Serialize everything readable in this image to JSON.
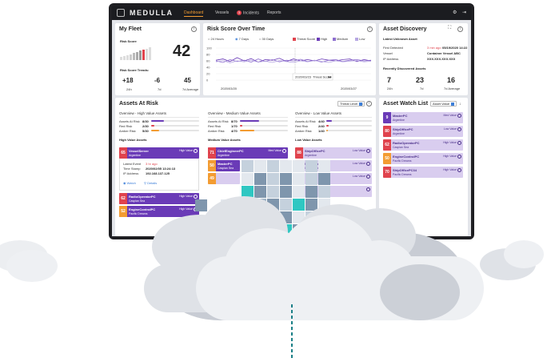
{
  "brand": {
    "name": "MEDULLA"
  },
  "nav": {
    "items": [
      {
        "label": "Dashboard"
      },
      {
        "label": "Vessels"
      },
      {
        "label": "Incidents",
        "badge": "3"
      },
      {
        "label": "Reports"
      }
    ],
    "active_color": "#f39c32"
  },
  "fleet": {
    "title": "My Fleet",
    "risk_score_label": "Risk Score",
    "risk_score": "42",
    "trends_label": "Risk Score Trends:",
    "trends": [
      {
        "value": "+18",
        "caption": "24h"
      },
      {
        "value": "-6",
        "caption": "7d"
      },
      {
        "value": "45",
        "caption": "7d Average"
      }
    ]
  },
  "risk_chart": {
    "title": "Risk Score Over Time",
    "ranges": [
      "24 Hours",
      "7 Days",
      "30 Days"
    ],
    "selected_range": "7 Days",
    "legend": [
      "Threat Score",
      "High",
      "Medium",
      "Low"
    ],
    "y_ticks": [
      "100",
      "80",
      "60",
      "40",
      "20",
      "0"
    ],
    "x_ticks": [
      "2020/03/20",
      "2020/03/27"
    ],
    "tooltip": {
      "date": "2020/03/23",
      "label": "Threat Score",
      "value": "64"
    }
  },
  "chart_data": {
    "type": "line",
    "title": "Risk Score Over Time",
    "ylim": [
      0,
      100
    ],
    "series": [
      {
        "name": "High",
        "values": [
          62,
          66,
          58,
          70,
          60,
          67,
          56,
          64,
          62,
          68,
          58,
          66,
          60,
          64,
          60,
          66,
          62,
          60,
          64,
          66,
          58,
          64,
          60
        ]
      },
      {
        "name": "Medium",
        "values": [
          60,
          55,
          64,
          58,
          62,
          56,
          66,
          58,
          64,
          57,
          62,
          60,
          65,
          58,
          62,
          56,
          62,
          64,
          58,
          62,
          64,
          60,
          62
        ]
      },
      {
        "name": "Low",
        "values": [
          57,
          61,
          54,
          60,
          57,
          62,
          56,
          59,
          55,
          61,
          58,
          55,
          60,
          57,
          61,
          58,
          55,
          60,
          57,
          59,
          61,
          57,
          59
        ]
      }
    ]
  },
  "asset_discovery": {
    "title": "Asset Discovery",
    "latest_unknown_label": "Latest Unknown Asset",
    "fields": [
      {
        "key": "First Detected",
        "ago": "3 min ago",
        "value": "05/19/2020 14:22"
      },
      {
        "key": "Vessel",
        "value": "Container Vessel ABC"
      },
      {
        "key": "IP Address",
        "value": "XXX.XXX.XXX.XXX"
      }
    ],
    "recent_label": "Recently Discovered Assets",
    "stats": [
      {
        "value": "7",
        "caption": "24h"
      },
      {
        "value": "23",
        "caption": "7d"
      },
      {
        "value": "16",
        "caption": "7d Average"
      }
    ]
  },
  "assets_at_risk": {
    "title": "Assets At Risk",
    "threat_select": "Threat Level",
    "columns": [
      {
        "overview": "Overview - High Value Assets",
        "rows": [
          {
            "label": "Assets At Risk",
            "value": "8/30",
            "color": "#6a3bb7",
            "pct": 0.27
          },
          {
            "label": "Red Risk",
            "value": "2/30",
            "color": "#e0434d",
            "pct": 0.07
          },
          {
            "label": "Amber Risk",
            "value": "5/30",
            "color": "#f39c32",
            "pct": 0.17
          }
        ],
        "section": "High Value Assets"
      },
      {
        "overview": "Overview - Medium Value Assets",
        "rows": [
          {
            "label": "Assets At Risk",
            "value": "8/70",
            "color": "#6a3bb7",
            "pct": 0.4
          },
          {
            "label": "Red Risk",
            "value": "1/70",
            "color": "#e0434d",
            "pct": 0.05
          },
          {
            "label": "Amber Risk",
            "value": "4/70",
            "color": "#f39c32",
            "pct": 0.3
          }
        ],
        "section": "Medium Value Assets"
      },
      {
        "overview": "Overview - Low Value Assets",
        "rows": [
          {
            "label": "Assets At Risk",
            "value": "4/40",
            "color": "#6a3bb7",
            "pct": 0.12
          },
          {
            "label": "Red Risk",
            "value": "2/40",
            "color": "#e0434d",
            "pct": 0.06
          },
          {
            "label": "Amber Risk",
            "value": "1/40",
            "color": "#f39c32",
            "pct": 0.04
          }
        ],
        "section": "Low Value Assets"
      }
    ],
    "high_assets": [
      {
        "score": "65",
        "name": "VesselServer",
        "sub": "Argentine",
        "tag": "High Value"
      },
      {
        "score": "62",
        "name": "RadioOperatorPC",
        "sub": "Caspian Sea",
        "tag": "High Value"
      },
      {
        "score": "52",
        "name": "EngineControlPC",
        "sub": "Pacific Dreams",
        "tag": "High Value"
      }
    ],
    "expanded": {
      "fields": [
        {
          "key": "Latest Event",
          "value": "3 hr ago"
        },
        {
          "key": "Time Stamp",
          "value": "2020/02/05 13:24:13"
        },
        {
          "key": "IP Address",
          "value": "192.168.137.125"
        }
      ],
      "actions": [
        "Watch",
        "Details"
      ]
    },
    "medium_assets": [
      {
        "score": "71",
        "name": "ChiefEngineerPC",
        "sub": "Argentine",
        "tag": "Med Value"
      },
      {
        "score": "50",
        "name": "MasterPC",
        "sub": "Caspian Sea",
        "tag": "Med Value"
      },
      {
        "score": "49",
        "name": "",
        "sub": "",
        "tag": ""
      }
    ],
    "low_assets": [
      {
        "score": "88",
        "name": "ShipOfficePC",
        "sub": "Argentine",
        "tag": "Low Value"
      },
      {
        "score": "60",
        "name": "ShipOfficePC2",
        "sub": "Caspian Sea",
        "tag": "Low Value"
      },
      {
        "score": "",
        "name": "",
        "sub": "",
        "tag": "Low Value"
      },
      {
        "score": "",
        "name": "",
        "sub": "",
        "tag": ""
      }
    ]
  },
  "watch_list": {
    "title": "Asset Watch List",
    "select": "Asset Value",
    "items": [
      {
        "score": "9",
        "name": "MasterPC",
        "sub": "Argentine",
        "tag": "Med Value",
        "color": "#6a3bb7"
      },
      {
        "score": "80",
        "name": "ShipOfficePC",
        "sub": "Argentine",
        "tag": "Low Value",
        "color": "#e0434d"
      },
      {
        "score": "62",
        "name": "RadioOperatorPC",
        "sub": "Caspian Sea",
        "tag": "High Value",
        "color": "#e0434d"
      },
      {
        "score": "50",
        "name": "EngineControlPC",
        "sub": "Pacific Dreams",
        "tag": "High Value",
        "color": "#f39c32"
      },
      {
        "score": "70",
        "name": "ShipOfficePC34",
        "sub": "Pacific Dreams",
        "tag": "High Value",
        "color": "#e0434d"
      }
    ]
  },
  "colors": {
    "purple": "#6a3bb7",
    "red": "#e0434d",
    "amber": "#f39c32",
    "lavender": "#d9cdef",
    "teal": "#2fc7c2",
    "steel": "#7f96ad"
  }
}
